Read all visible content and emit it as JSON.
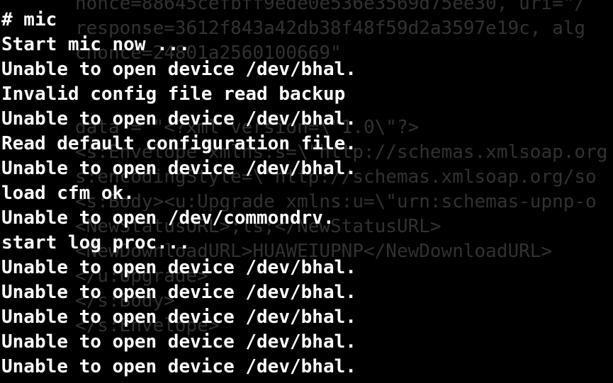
{
  "terminal": {
    "background": "#000000",
    "foreground": "#ffffff",
    "ghost_color": "#5a5a5a",
    "lines": [
      "# mic",
      "Start mic now ...",
      "Unable to open device /dev/bhal.",
      "Invalid config file read backup",
      "Unable to open device /dev/bhal.",
      "Read default configuration file.",
      "Unable to open device /dev/bhal.",
      "load cfm ok.",
      "Unable to open /dev/commondrv.",
      "start log proc...",
      "Unable to open device /dev/bhal.",
      "Unable to open device /dev/bhal.",
      "Unable to open device /dev/bhal.",
      "Unable to open device /dev/bhal.",
      "Unable to open device /dev/bhal."
    ],
    "ghost_lines": [
      "nonce=88645cefbff9ede0e536e3569d75ee30, uri=\"/",
      "response=3612f843a42db38f48f59d2a3597e19c, alg",
      "cnonce=24801a2560100669\"",
      "",
      "",
      "data = \"<?xml version=\\\"1.0\\\"?>",
      "<s:Envelope xmlns:s=\\\"http://schemas.xmlsoap.org",
      "s:encodingStyle=\\\"http://schemas.xmlsoap.org/so",
      "<s:Body><u:Upgrade xmlns:u=\\\"urn:schemas-upnp-o",
      "<NewStatusURL>;ls;</NewStatusURL>",
      "<NewDownloadURL>HUAWEIUPNP</NewDownloadURL>",
      "</u:Upgrade>",
      "</s:Body>",
      "</s:Envelope>",
      ""
    ]
  }
}
